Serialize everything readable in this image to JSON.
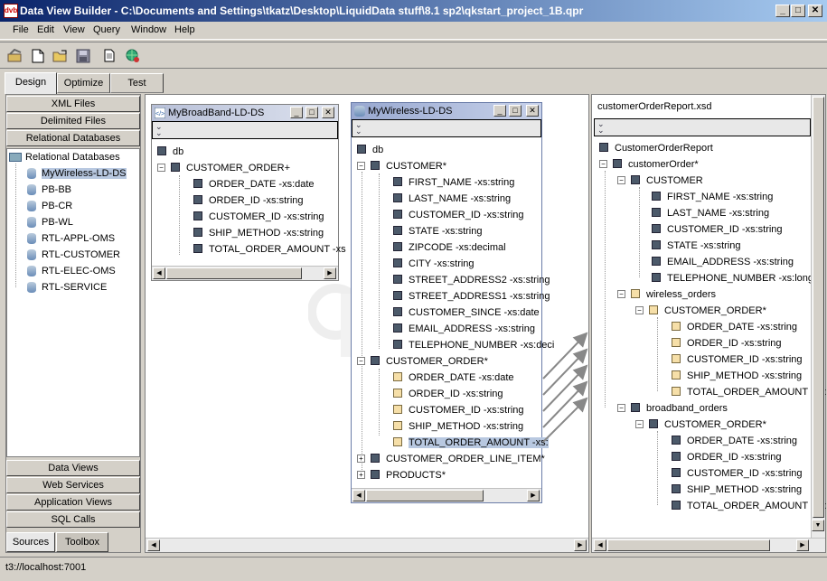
{
  "window": {
    "title": "Data View Builder - C:\\Documents and Settings\\tkatz\\Desktop\\LiquidData stuff\\8.1 sp2\\qkstart_project_1B.qpr",
    "icon_label": "dvb"
  },
  "window_controls": {
    "minimize": "_",
    "maximize": "□",
    "close": "✕"
  },
  "menu": [
    "File",
    "Edit",
    "View",
    "Query",
    "Window",
    "Help"
  ],
  "toolbar": [
    "open-project-icon",
    "new-file-icon",
    "open-folder-icon",
    "save-icon",
    "copy-document-icon",
    "globe-run-icon"
  ],
  "tabs": [
    "Design",
    "Optimize",
    "Test"
  ],
  "active_tab": "Design",
  "left_panel": {
    "top_sections": [
      "XML Files",
      "Delimited Files",
      "Relational Databases"
    ],
    "tree_root": "Relational Databases",
    "tree_items": [
      "MyWireless-LD-DS",
      "PB-BB",
      "PB-CR",
      "PB-WL",
      "RTL-APPL-OMS",
      "RTL-CUSTOMER",
      "RTL-ELEC-OMS",
      "RTL-SERVICE"
    ],
    "selected_item": "MyWireless-LD-DS",
    "bottom_sections": [
      "Data Views",
      "Web Services",
      "Application Views",
      "SQL Calls"
    ],
    "bottom_tabs": [
      "Sources",
      "Toolbox"
    ],
    "active_bottom_tab": "Sources"
  },
  "broadband_window": {
    "title": "MyBroadBand-LD-DS",
    "root": "db",
    "element": "CUSTOMER_ORDER+",
    "fields": [
      "ORDER_DATE -xs:date",
      "ORDER_ID -xs:string",
      "CUSTOMER_ID -xs:string",
      "SHIP_METHOD -xs:string",
      "TOTAL_ORDER_AMOUNT -xs"
    ]
  },
  "wireless_window": {
    "title": "MyWireless-LD-DS",
    "root": "db",
    "customer": "CUSTOMER*",
    "customer_fields": [
      "FIRST_NAME -xs:string",
      "LAST_NAME -xs:string",
      "CUSTOMER_ID -xs:string",
      "STATE -xs:string",
      "ZIPCODE -xs:decimal",
      "CITY -xs:string",
      "STREET_ADDRESS2 -xs:string",
      "STREET_ADDRESS1 -xs:string",
      "CUSTOMER_SINCE -xs:date",
      "EMAIL_ADDRESS -xs:string",
      "TELEPHONE_NUMBER -xs:deci"
    ],
    "order": "CUSTOMER_ORDER*",
    "order_fields": [
      "ORDER_DATE -xs:date",
      "ORDER_ID -xs:string",
      "CUSTOMER_ID -xs:string",
      "SHIP_METHOD -xs:string",
      "TOTAL_ORDER_AMOUNT -xs:"
    ],
    "highlighted_field": "TOTAL_ORDER_AMOUNT -xs:",
    "collapsed": [
      "CUSTOMER_ORDER_LINE_ITEM*",
      "PRODUCTS*"
    ]
  },
  "schema_panel": {
    "title": "customerOrderReport.xsd",
    "root": "CustomerOrderReport",
    "order": "customerOrder*",
    "customer": "CUSTOMER",
    "customer_fields": [
      "FIRST_NAME -xs:string",
      "LAST_NAME -xs:string",
      "CUSTOMER_ID -xs:string",
      "STATE -xs:string",
      "EMAIL_ADDRESS -xs:string",
      "TELEPHONE_NUMBER -xs:long"
    ],
    "wireless_group": "wireless_orders",
    "wireless_order": "CUSTOMER_ORDER*",
    "wireless_fields": [
      "ORDER_DATE -xs:string",
      "ORDER_ID -xs:string",
      "CUSTOMER_ID -xs:string",
      "SHIP_METHOD -xs:string",
      "TOTAL_ORDER_AMOUNT -xs:d"
    ],
    "broadband_group": "broadband_orders",
    "broadband_order": "CUSTOMER_ORDER*",
    "broadband_fields": [
      "ORDER_DATE -xs:string",
      "ORDER_ID -xs:string",
      "CUSTOMER_ID -xs:string",
      "SHIP_METHOD -xs:string",
      "TOTAL_ORDER_AMOUNT -xs:string"
    ]
  },
  "status": "t3://localhost:7001"
}
